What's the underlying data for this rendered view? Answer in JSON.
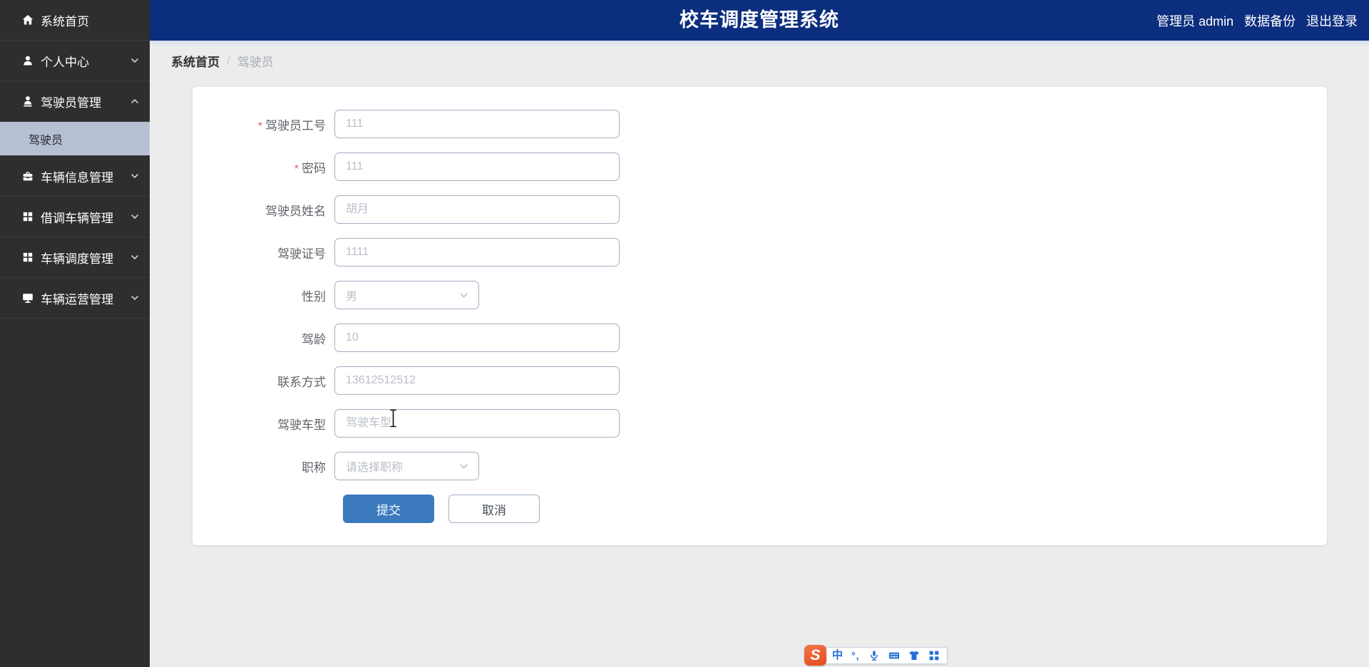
{
  "header": {
    "title": "校车调度管理系统",
    "user_label": "管理员 admin",
    "backup_label": "数据备份",
    "logout_label": "退出登录"
  },
  "sidebar": {
    "items": [
      {
        "label": "系统首页",
        "icon": "home-icon",
        "chevron": "none"
      },
      {
        "label": "个人中心",
        "icon": "user-icon",
        "chevron": "down"
      },
      {
        "label": "驾驶员管理",
        "icon": "driver-icon",
        "chevron": "up",
        "submenu": [
          {
            "label": "驾驶员",
            "active": true
          }
        ]
      },
      {
        "label": "车辆信息管理",
        "icon": "briefcase-icon",
        "chevron": "down"
      },
      {
        "label": "借调车辆管理",
        "icon": "grid-icon",
        "chevron": "down"
      },
      {
        "label": "车辆调度管理",
        "icon": "grid-icon",
        "chevron": "down"
      },
      {
        "label": "车辆运营管理",
        "icon": "monitor-icon",
        "chevron": "down"
      }
    ]
  },
  "breadcrumb": {
    "items": [
      "系统首页",
      "驾驶员"
    ],
    "separator": "/"
  },
  "form": {
    "fields": [
      {
        "label": "驾驶员工号",
        "required": true,
        "control": "input",
        "text": "111"
      },
      {
        "label": "密码",
        "required": true,
        "control": "input",
        "text": "111"
      },
      {
        "label": "驾驶员姓名",
        "required": false,
        "control": "input",
        "text": "胡月"
      },
      {
        "label": "驾驶证号",
        "required": false,
        "control": "input",
        "text": "1111"
      },
      {
        "label": "性别",
        "required": false,
        "control": "select",
        "text": "男"
      },
      {
        "label": "驾龄",
        "required": false,
        "control": "input",
        "text": "10"
      },
      {
        "label": "联系方式",
        "required": false,
        "control": "input",
        "text": "13612512512"
      },
      {
        "label": "驾驶车型",
        "required": false,
        "control": "input",
        "text": "驾驶车型",
        "focused": true
      },
      {
        "label": "职称",
        "required": false,
        "control": "select",
        "text": "请选择职称"
      }
    ],
    "submit_label": "提交",
    "cancel_label": "取消"
  },
  "ime_toolbar": {
    "logo_letter": "S",
    "logo_name": "sogou-logo",
    "icons": [
      "chinese-mode-icon",
      "punctuation-icon",
      "microphone-icon",
      "soft-keyboard-icon",
      "skin-icon",
      "toolbox-icon"
    ]
  },
  "colors": {
    "header_bg": "#0c2e7e",
    "sidebar_bg": "#2e2e2e",
    "submenu_active_bg": "#b7c0d3",
    "content_bg": "#ececec",
    "submit_blue": "#3a7abd",
    "required_red": "#ee5b5b",
    "input_border": "#a3aebf",
    "placeholder_gray": "#b9bec7",
    "ime_blue": "#2170d5",
    "ime_orange": "#e34b1e"
  }
}
